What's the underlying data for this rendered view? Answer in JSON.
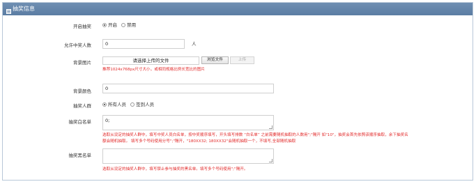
{
  "panel": {
    "title": "抽奖信息",
    "icon": "list-icon"
  },
  "fields": {
    "enable": {
      "label": "开启抽奖",
      "options": [
        "开启",
        "禁用"
      ],
      "selected": "开启"
    },
    "winners": {
      "label": "允许中奖人数",
      "value": "0",
      "unit": "人"
    },
    "background": {
      "label": "背景图片",
      "file_placeholder": "请选择上传的文件",
      "browse_label": "浏览文件",
      "upload_label": "上传",
      "hint": "推荐1024x768px尺寸大小，或相同规格比例长宽比的图片"
    },
    "bg_color": {
      "label": "背景颜色",
      "value": "0"
    },
    "crowd": {
      "label": "抽奖人群",
      "options": [
        "所有人员",
        "签到人员"
      ],
      "selected": "所有人员"
    },
    "whitelist": {
      "label": "抽奖白名单",
      "value": "0;",
      "hint_line1": "选取从设定的抽奖人群中，填写中奖人员白名单，按中奖顺序填写，开头填写排数 “白名单” 之前需要随机抽取的人数用\";\"隔开 如\"10\"，抽奖会首先依照该顺序抽取，余下抽奖名",
      "hint_line2": "额会随机抽取。 填写多个号码使用分号\";\"隔开，\"180XX32; 180XX32\"会随机抽取一个，不填写,全部随机抽取"
    },
    "blacklist": {
      "label": "抽奖黑名单",
      "value": "",
      "hint": "选取从设定的抽奖人群中，填写禁止参与抽奖的黑名单。填写多个号码使用\";\"隔开。"
    }
  },
  "colors": {
    "header": "#6383a8",
    "hint": "#e22b2b",
    "border": "#b8c7d8"
  }
}
